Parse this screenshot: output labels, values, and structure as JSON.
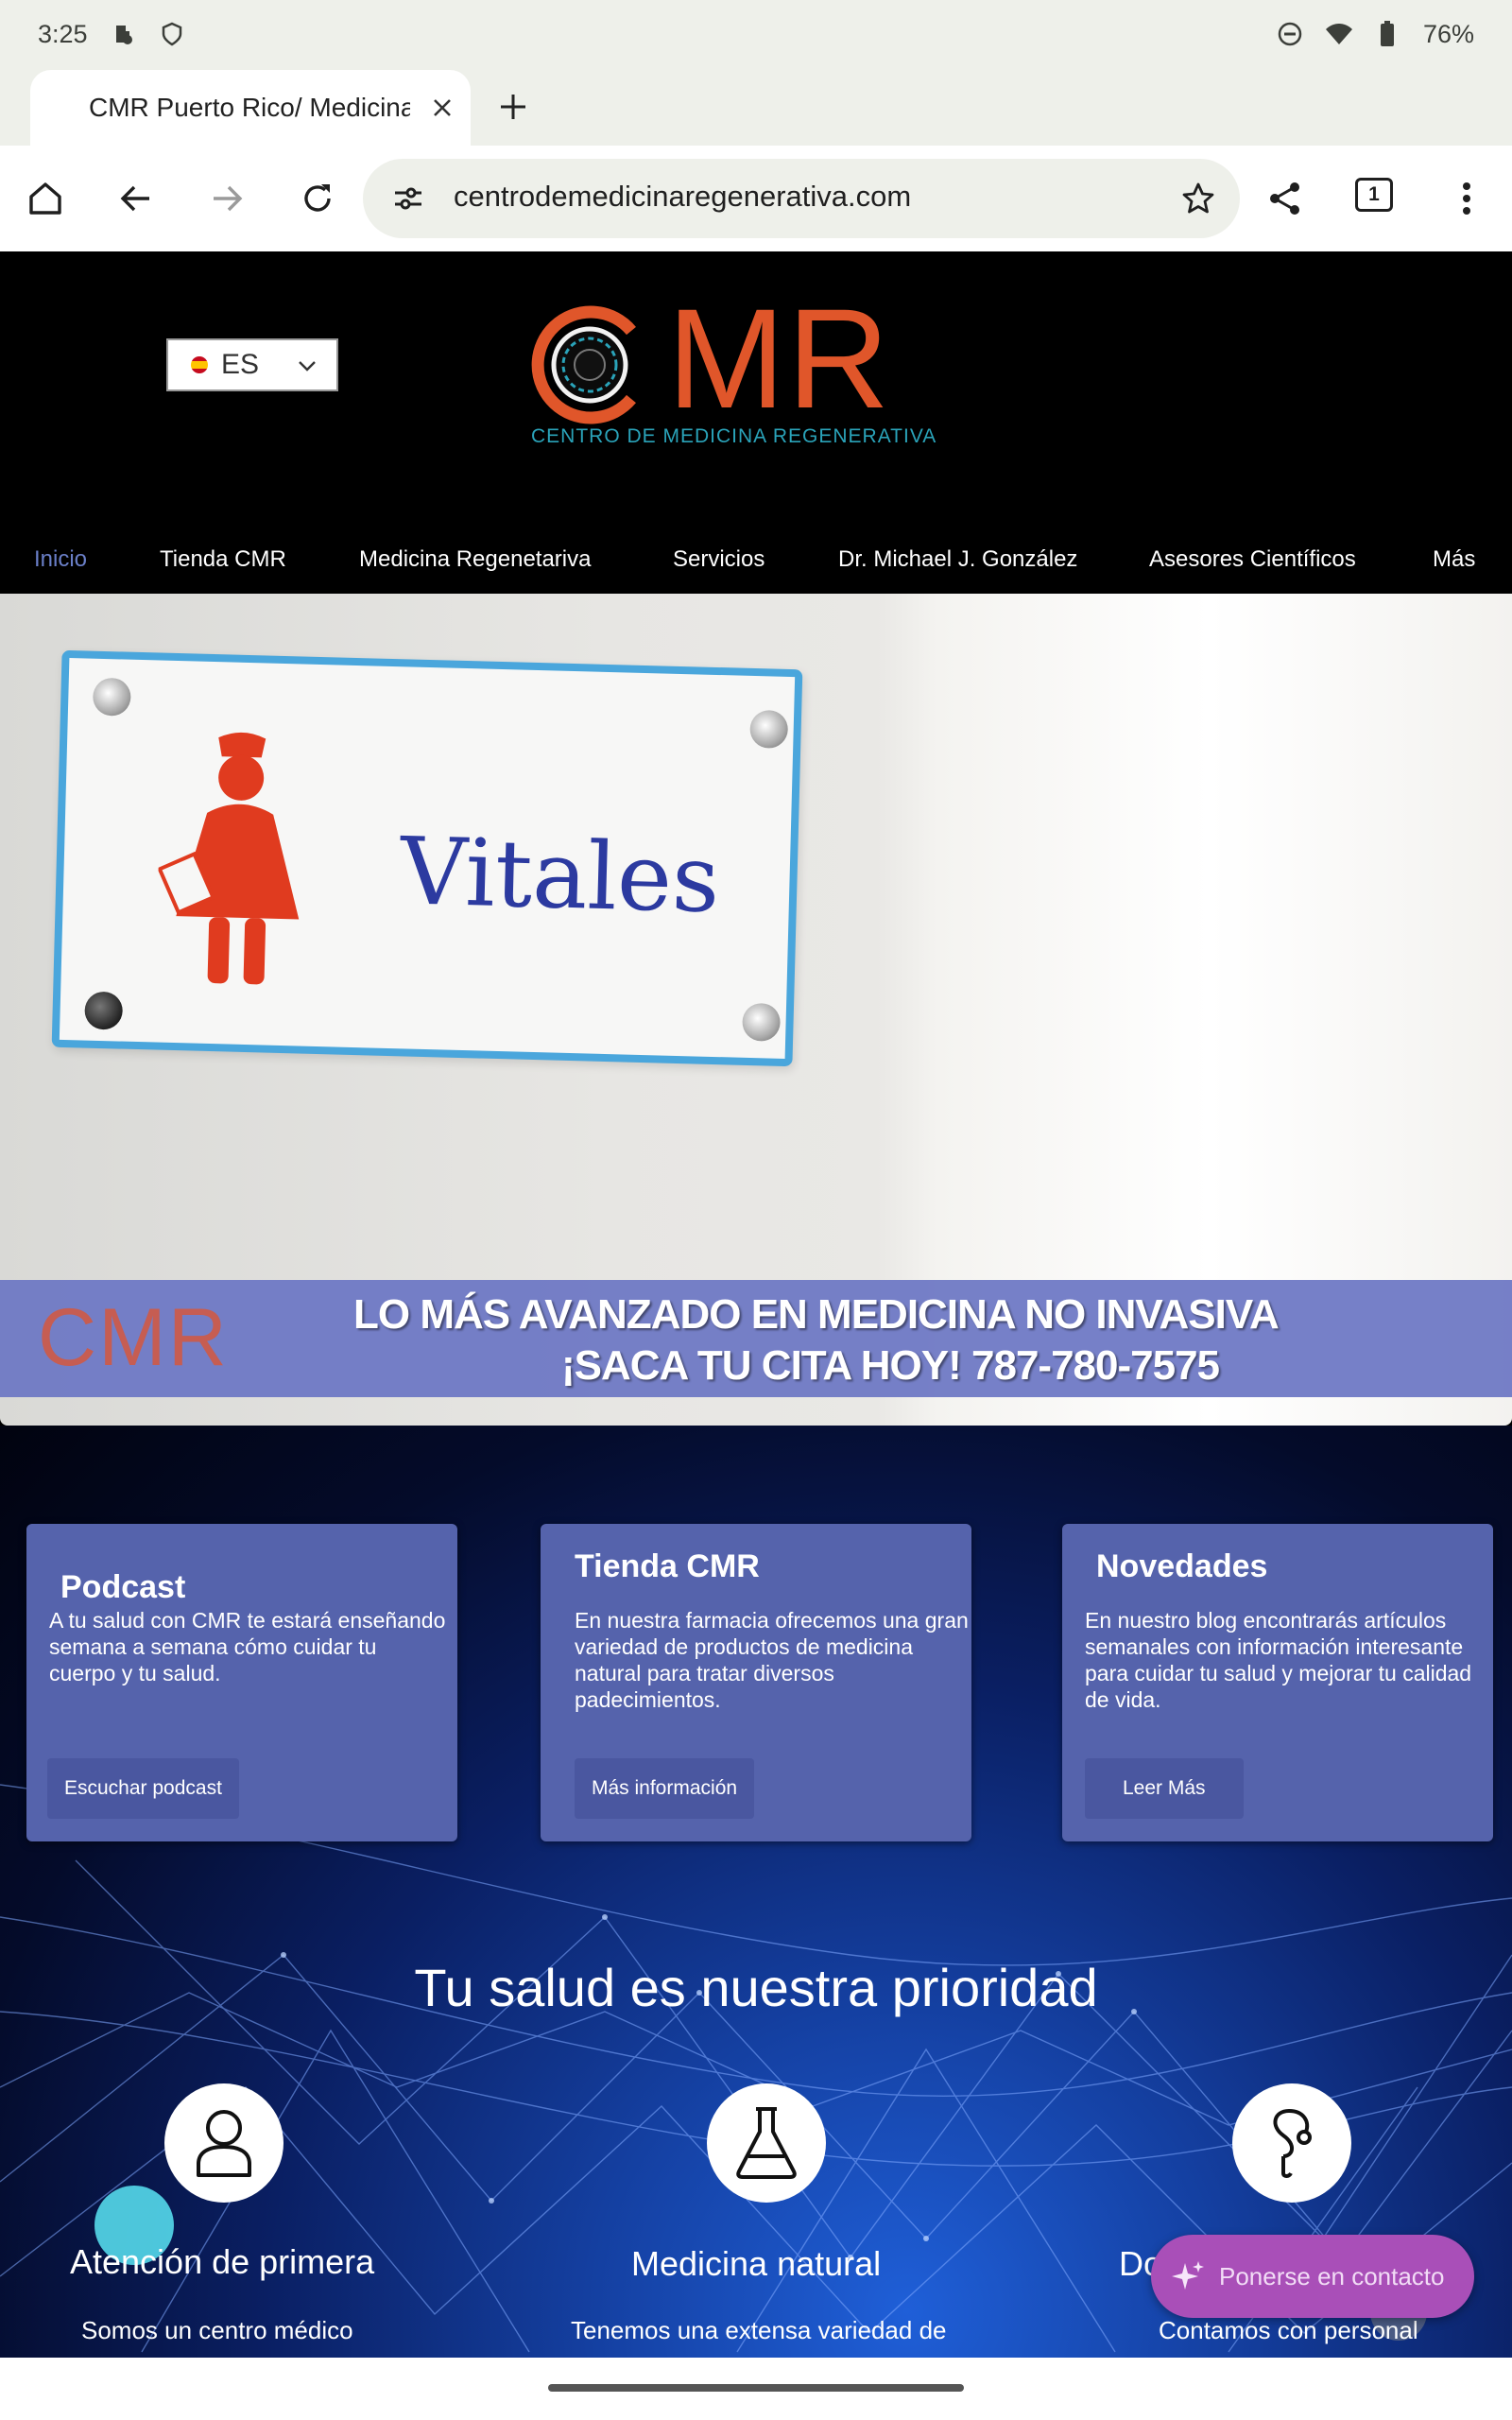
{
  "status_bar": {
    "time": "3:25",
    "battery": "76%",
    "icons": [
      "work-profile-icon",
      "shield-icon",
      "dnd-icon",
      "wifi-icon",
      "battery-icon"
    ]
  },
  "browser": {
    "tab_title": "CMR Puerto Rico/ Medicina",
    "url": "centrodemedicinaregenerativa.com",
    "tab_count": "1"
  },
  "site": {
    "language": "ES",
    "logo": {
      "letters": "CMR",
      "subtitle": "CENTRO DE MEDICINA REGENERATIVA"
    },
    "nav": [
      {
        "label": "Inicio",
        "active": true
      },
      {
        "label": "Tienda CMR"
      },
      {
        "label": "Medicina Regenetariva"
      },
      {
        "label": "Servicios"
      },
      {
        "label": "Dr. Michael J. González"
      },
      {
        "label": "Asesores Científicos"
      },
      {
        "label": "Más"
      }
    ],
    "hero": {
      "sign_text": "Vitales",
      "banner_logo": "CMR",
      "banner_line1": "LO MÁS AVANZADO EN MEDICINA NO INVASIVA",
      "banner_line2": "¡SACA TU CITA HOY!  787-780-7575"
    },
    "cards": [
      {
        "title": "Podcast",
        "text": "A tu salud con CMR te estará enseñando semana a semana cómo cuidar tu cuerpo y tu salud.",
        "button": "Escuchar podcast"
      },
      {
        "title": "Tienda CMR",
        "text": "En nuestra farmacia ofrecemos una gran variedad de productos de medicina natural para tratar diversos padecimientos.",
        "button": "Más información"
      },
      {
        "title": "Novedades",
        "text": "En nuestro blog encontrarás artículos semanales con información interesante para cuidar tu salud y mejorar tu calidad de vida.",
        "button": "Leer Más"
      }
    ],
    "priority_heading": "Tu salud es nuestra prioridad",
    "features": [
      {
        "title": "Atención de primera",
        "text": "Somos un centro médico",
        "icon": "person-icon"
      },
      {
        "title": "Medicina natural",
        "text": "Tenemos una extensa variedad de",
        "icon": "flask-icon"
      },
      {
        "title": "Do",
        "text": "Contamos con personal",
        "icon": "stethoscope-icon"
      }
    ],
    "contact_button": "Ponerse en contacto"
  },
  "colors": {
    "brand_orange": "#e0562a",
    "brand_teal": "#2aa3b9",
    "card_blue": "#5563ac",
    "nav_active": "#6a7fc8",
    "contact_purple": "#a94fb8"
  }
}
